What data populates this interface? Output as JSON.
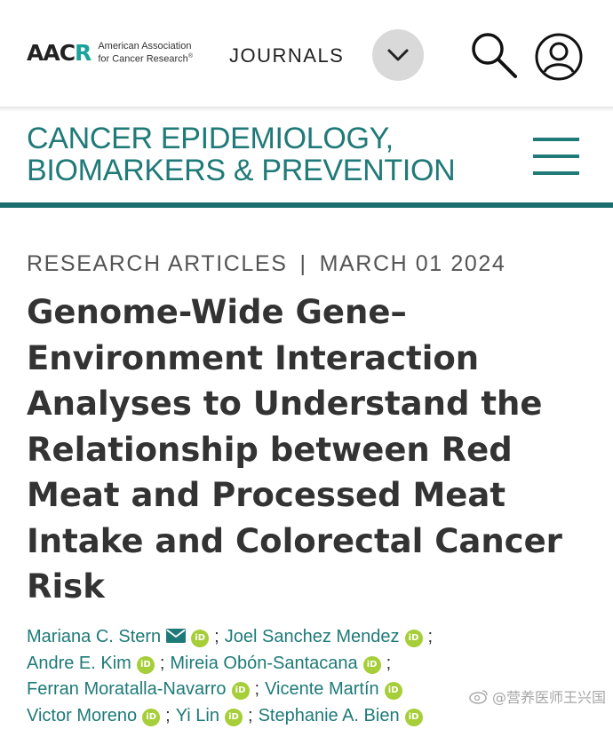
{
  "header": {
    "logo_mark_left": "AAC",
    "logo_mark_accent": "R",
    "logo_text_line1": "American Association",
    "logo_text_line2": "for Cancer Research",
    "logo_reg": "®",
    "journals_label": "JOURNALS"
  },
  "journal": {
    "name_line1": "CANCER EPIDEMIOLOGY,",
    "name_line2": "BIOMARKERS & PREVENTION"
  },
  "article": {
    "section": "RESEARCH ARTICLES",
    "separator": "|",
    "date": "MARCH 01 2024",
    "title": "Genome-Wide Gene–Environment Interaction Analyses to Understand the Relationship between Red Meat and Processed Meat Intake and Colorectal Cancer Risk",
    "authors": [
      "Mariana C. Stern",
      "Joel Sanchez Mendez",
      "Andre E. Kim",
      "Mireia Obón-Santacana",
      "Ferran Moratalla-Navarro",
      "Vicente Martín",
      "Victor Moreno",
      "Yi Lin",
      "Stephanie A. Bien"
    ],
    "author_separator": ";",
    "orcid_label": "iD"
  },
  "watermark": {
    "text": "@营养医师王兴国"
  },
  "colors": {
    "teal": "#1f7a78",
    "teal_rule": "#1a6f6e",
    "orcid_green": "#a6ce39",
    "title_text": "#333333"
  },
  "icons": {
    "expand": "chevron-down-icon",
    "search": "search-icon",
    "account": "user-account-icon",
    "menu": "hamburger-menu-icon",
    "email": "envelope-icon",
    "orcid": "orcid-icon"
  }
}
